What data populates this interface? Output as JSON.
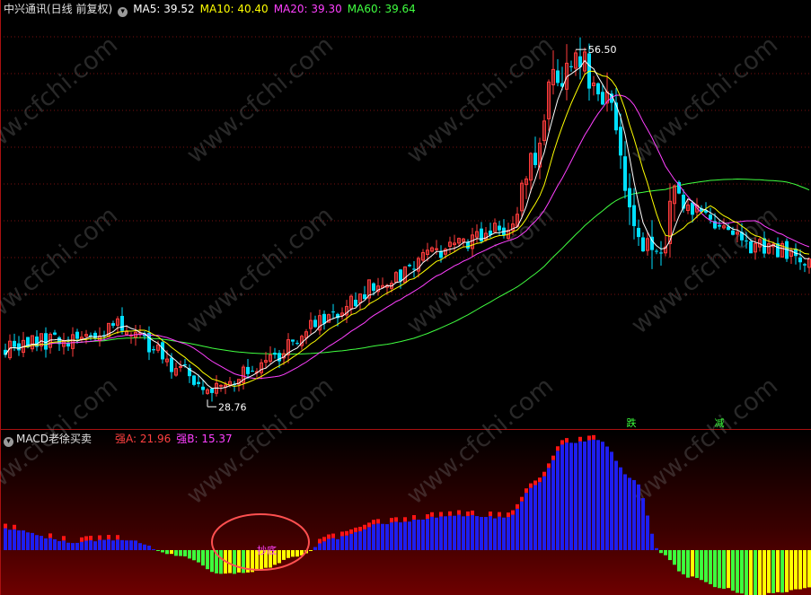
{
  "panel_top": {
    "stock_name": "中兴通讯(日线 前复权)",
    "ma": [
      {
        "label": "MA5:",
        "value": "39.52",
        "color": "#ffffff"
      },
      {
        "label": "MA10:",
        "value": "40.40",
        "color": "#ffff00"
      },
      {
        "label": "MA20:",
        "value": "39.30",
        "color": "#ff40ff"
      },
      {
        "label": "MA60:",
        "value": "39.64",
        "color": "#40ff40"
      }
    ],
    "high_marker": "56.50",
    "low_marker": "28.76",
    "signals": [
      "跌",
      "减"
    ]
  },
  "panel_bottom": {
    "indicator_name": "MACD老徐买卖",
    "strong_a_label": "强A:",
    "strong_a_value": "21.96",
    "strong_b_label": "强B:",
    "strong_b_value": "15.37",
    "circle_annotation": "抄底"
  },
  "watermark": "www.cfchi.com",
  "colors": {
    "up": "#ff3c3c",
    "down": "#00e0ff",
    "ma5": "#ffffff",
    "ma10": "#ffff00",
    "ma20": "#ff40ff",
    "ma60": "#40ff40",
    "macd_blue": "#1e1ef0",
    "macd_red": "#ff1414",
    "macd_yellow": "#ffff00",
    "macd_green": "#3cff3c"
  },
  "chart_data": [
    {
      "type": "candlestick",
      "title": "中兴通讯(日线 前复权)",
      "price_range_visible": [
        27,
        59
      ],
      "labeled_high": 56.5,
      "labeled_low": 28.76,
      "close_path_keypoints": [
        {
          "bar": 0,
          "price": 33.0
        },
        {
          "bar": 15,
          "price": 33.6
        },
        {
          "bar": 26,
          "price": 34.6
        },
        {
          "bar": 39,
          "price": 31.4
        },
        {
          "bar": 45,
          "price": 29.2
        },
        {
          "bar": 55,
          "price": 31.2
        },
        {
          "bar": 70,
          "price": 34.8
        },
        {
          "bar": 85,
          "price": 38.3
        },
        {
          "bar": 95,
          "price": 40.5
        },
        {
          "bar": 105,
          "price": 41.5
        },
        {
          "bar": 112,
          "price": 42.5
        },
        {
          "bar": 118,
          "price": 48.0
        },
        {
          "bar": 122,
          "price": 54.0
        },
        {
          "bar": 127,
          "price": 55.5
        },
        {
          "bar": 131,
          "price": 54.5
        },
        {
          "bar": 135,
          "price": 52.0
        },
        {
          "bar": 140,
          "price": 42.0
        },
        {
          "bar": 144,
          "price": 40.0
        },
        {
          "bar": 150,
          "price": 44.5
        },
        {
          "bar": 158,
          "price": 43.0
        },
        {
          "bar": 165,
          "price": 41.0
        },
        {
          "bar": 172,
          "price": 40.5
        },
        {
          "bar": 179,
          "price": 39.5
        }
      ],
      "ma_latest": {
        "MA5": 39.52,
        "MA10": 40.4,
        "MA20": 39.3,
        "MA60": 39.64
      }
    },
    {
      "type": "bar",
      "title": "MACD老徐买卖",
      "series": [
        {
          "name": "强A",
          "latest": 21.96
        },
        {
          "name": "强B",
          "latest": 15.37
        }
      ],
      "value_keypoints": [
        {
          "bar": 0,
          "value": 4.0
        },
        {
          "bar": 15,
          "value": 1.5
        },
        {
          "bar": 26,
          "value": 2.0
        },
        {
          "bar": 39,
          "value": -1.0
        },
        {
          "bar": 48,
          "value": -4.5
        },
        {
          "bar": 55,
          "value": -4.0
        },
        {
          "bar": 66,
          "value": -1.0
        },
        {
          "bar": 72,
          "value": 2.0
        },
        {
          "bar": 85,
          "value": 5.0
        },
        {
          "bar": 100,
          "value": 6.5
        },
        {
          "bar": 112,
          "value": 6.0
        },
        {
          "bar": 118,
          "value": 12.0
        },
        {
          "bar": 125,
          "value": 20.0
        },
        {
          "bar": 132,
          "value": 20.5
        },
        {
          "bar": 140,
          "value": 13.0
        },
        {
          "bar": 146,
          "value": -0.5
        },
        {
          "bar": 152,
          "value": -5.0
        },
        {
          "bar": 160,
          "value": -7.0
        },
        {
          "bar": 166,
          "value": -8.5
        },
        {
          "bar": 172,
          "value": -8.0
        },
        {
          "bar": 179,
          "value": -7.0
        }
      ]
    }
  ]
}
